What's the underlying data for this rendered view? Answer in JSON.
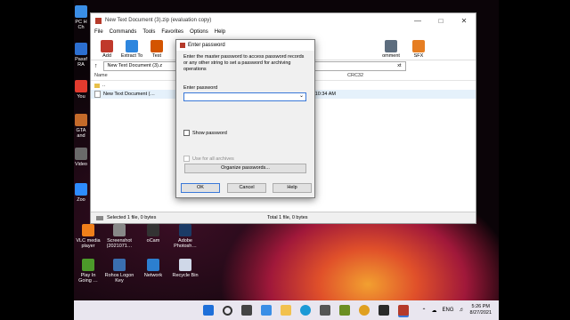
{
  "desktop": {
    "icons": [
      {
        "label": "PC H",
        "label2": "Ch",
        "color": "#3a8ee6"
      },
      {
        "label": "Passf",
        "label2": "RA",
        "color": "#2c6fd0"
      },
      {
        "label": "You",
        "label2": "",
        "color": "#e23b2e"
      },
      {
        "label": "GTA",
        "label2": "and",
        "color": "#c46a2a"
      },
      {
        "label": "Video",
        "label2": "",
        "color": "#6a6a6a"
      },
      {
        "label": "Zoo",
        "label2": "",
        "color": "#2d8cff"
      }
    ],
    "bottom_icons": [
      {
        "label": "VLC media",
        "label2": "player",
        "color": "#f07f1a"
      },
      {
        "label": "Screenshot",
        "label2": "(2021071…",
        "color": "#888888"
      },
      {
        "label": "oCam",
        "label2": "",
        "color": "#333333"
      },
      {
        "label": "Adobe",
        "label2": "Photosh…",
        "color": "#1b3b66"
      },
      {
        "label": "Play In",
        "label2": "Going …",
        "color": "#4c9a2a"
      },
      {
        "label": "Rohos Logon",
        "label2": "Key",
        "color": "#3a6fb0"
      },
      {
        "label": "Network",
        "label2": "",
        "color": "#2c7fd0"
      },
      {
        "label": "Recycle Bin",
        "label2": "",
        "color": "#cfd8e8"
      }
    ]
  },
  "app": {
    "title": "New Text Document (3).zip (evaluation copy)",
    "menu": [
      "File",
      "Commands",
      "Tools",
      "Favorites",
      "Options",
      "Help"
    ],
    "toolbar": [
      {
        "label": "Add",
        "color": "#c0392b"
      },
      {
        "label": "Extract To",
        "color": "#2e86de"
      },
      {
        "label": "Test",
        "color": "#d35400"
      },
      {
        "label": "Vi",
        "color": "#7f8c8d"
      }
    ],
    "toolbar_right": [
      {
        "label": "omment",
        "color": "#5d6d7e"
      },
      {
        "label": "SFX",
        "color": "#e67e22"
      }
    ],
    "address": "New Text Document (3).z",
    "address_right": "xt",
    "columns": {
      "name": "Name",
      "modified": "ied",
      "crc": "CRC32"
    },
    "rows": [
      {
        "name": "..",
        "modified": ""
      },
      {
        "name": "New Text Document (…",
        "modified": "021 10:34 AM"
      }
    ],
    "status_left": "Selected 1 file, 0 bytes",
    "status_right": "Total 1 file, 0 bytes"
  },
  "dialog": {
    "title": "Enter password",
    "description": "Enter the master password to access password records or any other string to set a password for archiving operations",
    "label": "Enter password",
    "password_value": "",
    "show_password": "Show password",
    "use_for_all": "Use for all archives",
    "organize": "Organize passwords...",
    "ok": "OK",
    "cancel": "Cancel",
    "help": "Help"
  },
  "taskbar": {
    "lang": "ENG",
    "time": "5:26 PM",
    "date": "8/27/2021",
    "icons": [
      "start-icon",
      "search-icon",
      "task-view-icon",
      "widgets-icon",
      "file-explorer-icon",
      "edge-icon",
      "store-icon",
      "mail-icon",
      "chrome-icon",
      "app-icon",
      "winrar-icon"
    ]
  }
}
